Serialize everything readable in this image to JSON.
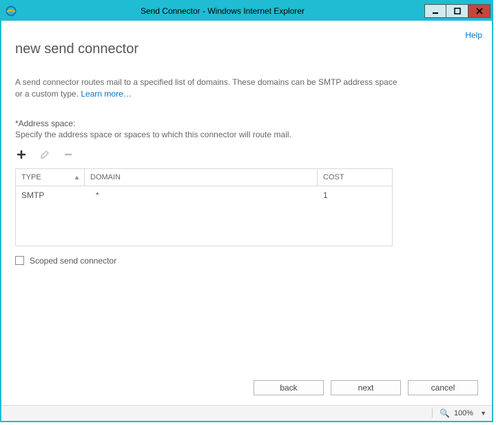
{
  "window": {
    "title": "Send Connector - Windows Internet Explorer"
  },
  "header": {
    "help": "Help"
  },
  "page": {
    "title": "new send connector",
    "description_pre": "A send connector routes mail to a specified list of domains. These domains can be SMTP address space or a custom type. ",
    "learn_more": "Learn more…",
    "address_label": "*Address space:",
    "address_sub": "Specify the address space or spaces to which this connector will route mail."
  },
  "table": {
    "headers": {
      "type": "TYPE",
      "domain": "DOMAIN",
      "cost": "COST"
    },
    "rows": [
      {
        "type": "SMTP",
        "domain": "*",
        "cost": "1"
      }
    ]
  },
  "checkbox": {
    "label": "Scoped send connector",
    "checked": false
  },
  "buttons": {
    "back": "back",
    "next": "next",
    "cancel": "cancel"
  },
  "status": {
    "zoom": "100%"
  }
}
